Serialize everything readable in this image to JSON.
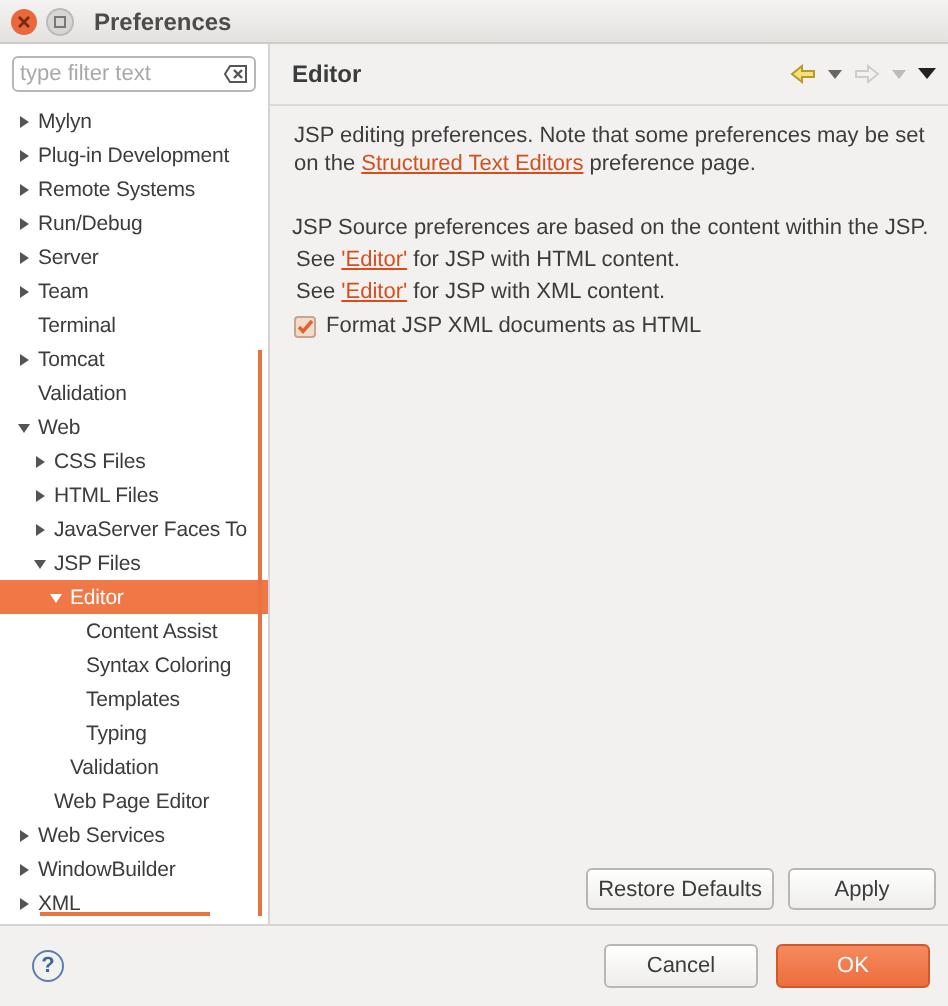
{
  "window": {
    "title": "Preferences"
  },
  "filter": {
    "placeholder": "type filter text"
  },
  "tree": [
    {
      "label": "Mylyn",
      "expanded": false,
      "selected": false
    },
    {
      "label": "Plug-in Development",
      "expanded": false,
      "selected": false
    },
    {
      "label": "Remote Systems",
      "expanded": false,
      "selected": false
    },
    {
      "label": "Run/Debug",
      "expanded": false,
      "selected": false
    },
    {
      "label": "Server",
      "expanded": false,
      "selected": false
    },
    {
      "label": "Team",
      "expanded": false,
      "selected": false
    },
    {
      "label": "Terminal",
      "selected": false
    },
    {
      "label": "Tomcat",
      "expanded": false,
      "selected": false
    },
    {
      "label": "Validation",
      "selected": false
    },
    {
      "label": "Web",
      "expanded": true,
      "selected": false,
      "children": [
        {
          "label": "CSS Files",
          "expanded": false,
          "selected": false
        },
        {
          "label": "HTML Files",
          "expanded": false,
          "selected": false
        },
        {
          "label": "JavaServer Faces To",
          "expanded": false,
          "selected": false
        },
        {
          "label": "JSP Files",
          "expanded": true,
          "selected": false,
          "children": [
            {
              "label": "Editor",
              "expanded": true,
              "selected": true,
              "children": [
                {
                  "label": "Content Assist",
                  "selected": false
                },
                {
                  "label": "Syntax Coloring",
                  "selected": false
                },
                {
                  "label": "Templates",
                  "selected": false
                },
                {
                  "label": "Typing",
                  "selected": false
                }
              ]
            },
            {
              "label": "Validation",
              "selected": false
            }
          ]
        },
        {
          "label": "Web Page Editor",
          "selected": false
        }
      ]
    },
    {
      "label": "Web Services",
      "expanded": false,
      "selected": false
    },
    {
      "label": "WindowBuilder",
      "expanded": false,
      "selected": false
    },
    {
      "label": "XML",
      "expanded": false,
      "selected": false
    }
  ],
  "page": {
    "title": "Editor",
    "intro": {
      "before": "JSP editing preferences.  Note that some preferences may be set on the ",
      "link": "Structured Text Editors",
      "after": " preference page."
    },
    "source_note": "JSP Source preferences are based on the content within the JSP.",
    "see_lines": [
      {
        "before": "See ",
        "link": "'Editor'",
        "after": " for JSP with HTML content."
      },
      {
        "before": "See ",
        "link": "'Editor'",
        "after": " for JSP with XML content."
      }
    ],
    "checkbox": {
      "label": "Format JSP XML documents as HTML",
      "checked": true
    },
    "buttons": [
      "Restore Defaults",
      "Apply"
    ]
  },
  "footer": {
    "help": "?",
    "buttons": [
      {
        "label": "Cancel",
        "kind": "normal"
      },
      {
        "label": "OK",
        "kind": "default"
      }
    ]
  }
}
